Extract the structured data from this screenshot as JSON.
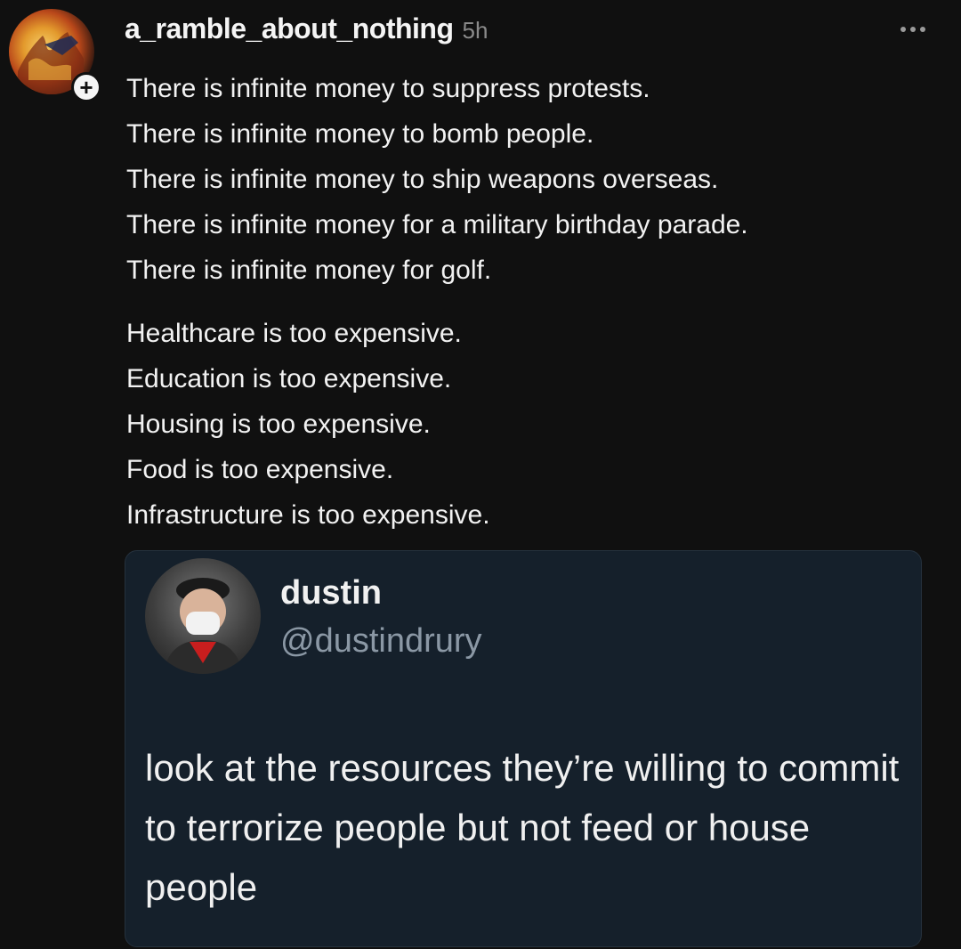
{
  "post": {
    "username": "a_ramble_about_nothing",
    "timestamp": "5h",
    "avatar_icon": "fire-avatar-icon",
    "follow_badge": "+",
    "more_icon": "more-dots-icon",
    "paragraph1": [
      "There is infinite money to suppress protests.",
      "There is infinite money to bomb people.",
      "There is infinite money to ship weapons overseas.",
      "There is infinite money for a military birthday parade.",
      "There is infinite money for golf."
    ],
    "paragraph2": [
      "Healthcare is too expensive.",
      "Education is too expensive.",
      "Housing is too expensive.",
      "Food is too expensive.",
      "Infrastructure is too expensive."
    ]
  },
  "quote": {
    "name": "dustin",
    "handle": "@dustindrury",
    "text": "look at the resources they’re willing to commit to terrorize people but not feed or house people",
    "card_bg": "#15202b"
  }
}
